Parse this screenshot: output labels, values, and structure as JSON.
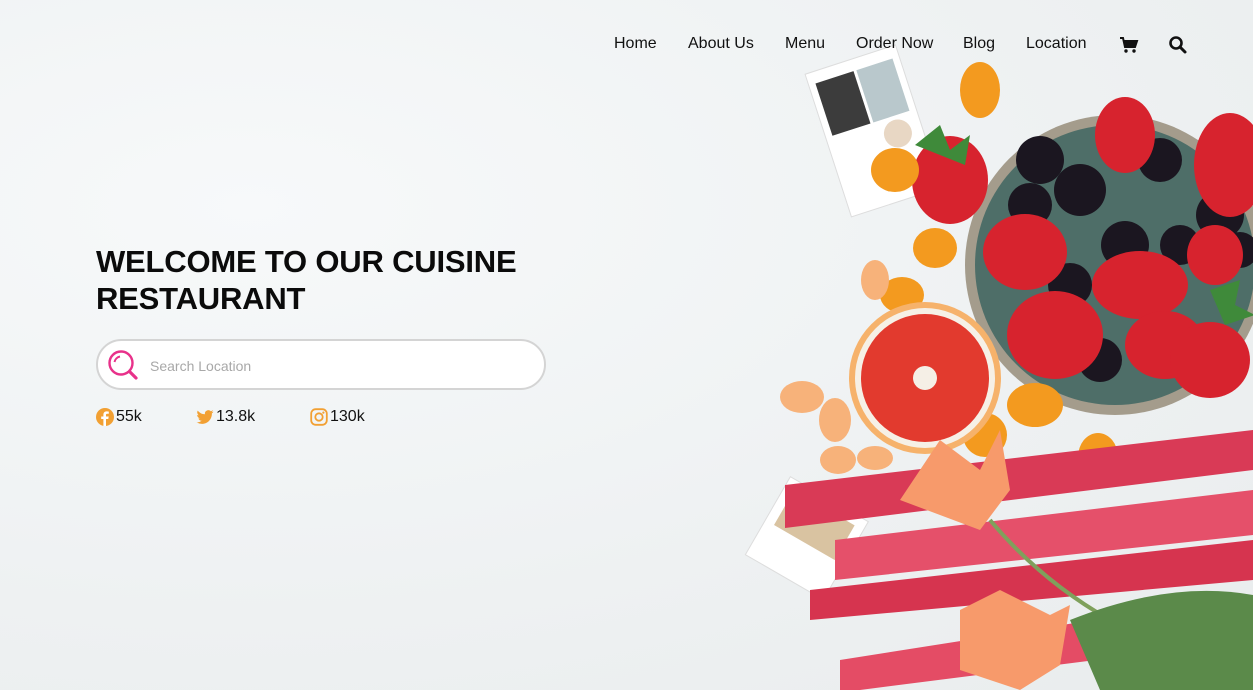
{
  "nav": {
    "items": [
      {
        "label": "Home"
      },
      {
        "label": "About Us"
      },
      {
        "label": "Menu"
      },
      {
        "label": "Order Now"
      },
      {
        "label": "Blog"
      },
      {
        "label": "Location"
      }
    ],
    "cart_icon": "cart-icon",
    "search_icon": "search-icon"
  },
  "hero": {
    "title_line1": "WELCOME TO OUR CUISINE",
    "title_line2": "RESTAURANT",
    "search": {
      "placeholder": "Search Location",
      "value": ""
    }
  },
  "social": {
    "facebook": {
      "icon": "facebook-icon",
      "count": "55k"
    },
    "twitter": {
      "icon": "twitter-icon",
      "count": "13.8k"
    },
    "instagram": {
      "icon": "instagram-icon",
      "count": "130k"
    }
  },
  "colors": {
    "accent": "#e8318a",
    "social_icon": "#f2a033",
    "text": "#111111"
  }
}
